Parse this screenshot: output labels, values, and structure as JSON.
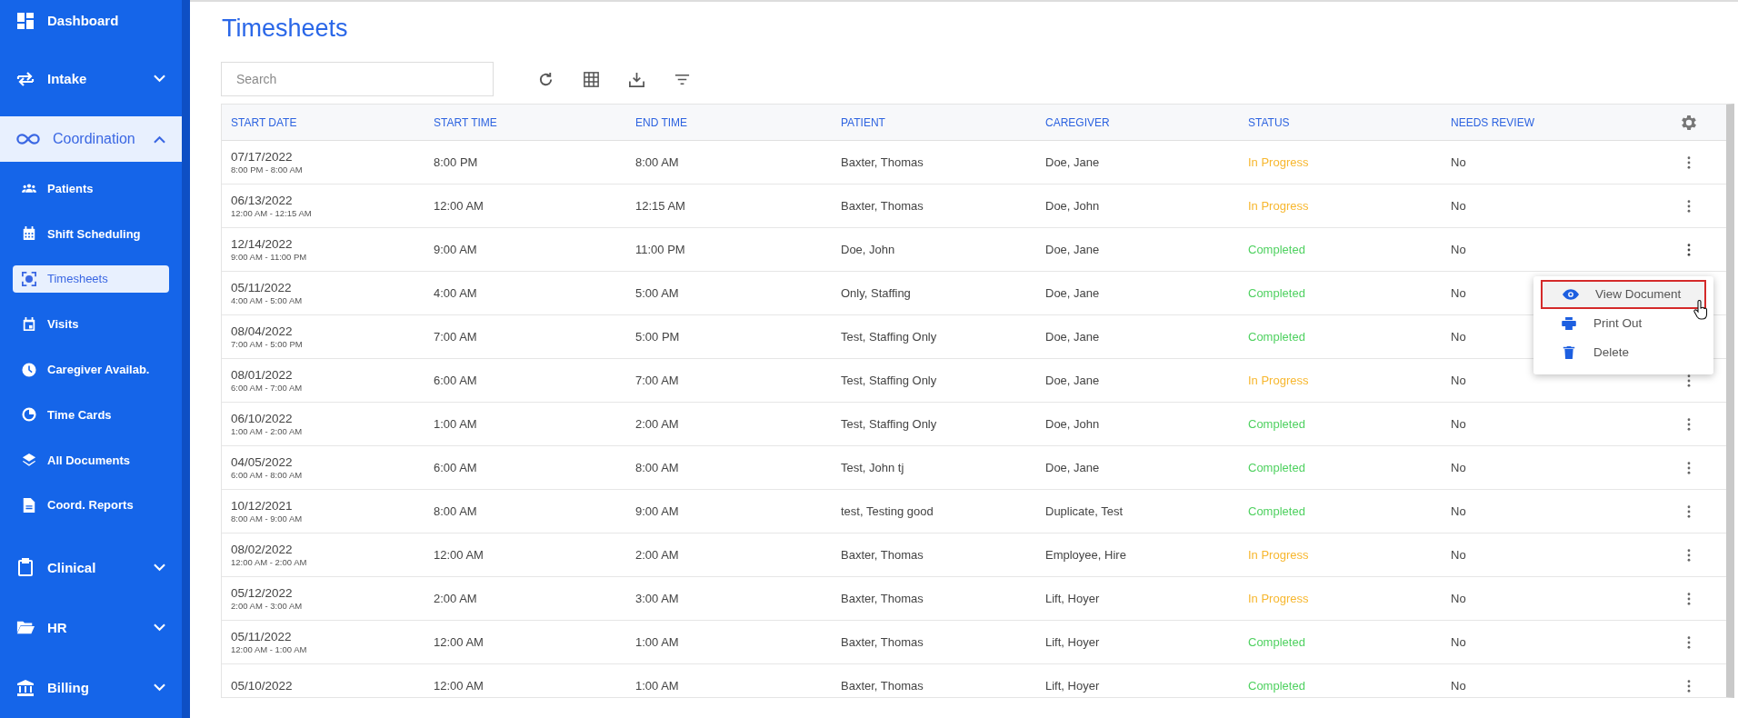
{
  "sidebar": {
    "items": [
      {
        "label": "Dashboard",
        "kind": "link",
        "selected": false
      },
      {
        "label": "Intake",
        "kind": "section",
        "selected": false,
        "expanded": false
      },
      {
        "label": "Coordination",
        "kind": "section",
        "selected": true,
        "expanded": true,
        "children": [
          {
            "label": "Patients",
            "selected": false
          },
          {
            "label": "Shift Scheduling",
            "selected": false
          },
          {
            "label": "Timesheets",
            "selected": true
          },
          {
            "label": "Visits",
            "selected": false
          },
          {
            "label": "Caregiver Availab.",
            "selected": false
          },
          {
            "label": "Time Cards",
            "selected": false
          },
          {
            "label": "All Documents",
            "selected": false
          },
          {
            "label": "Coord. Reports",
            "selected": false
          }
        ]
      },
      {
        "label": "Clinical",
        "kind": "section",
        "selected": false,
        "expanded": false
      },
      {
        "label": "HR",
        "kind": "section",
        "selected": false,
        "expanded": false
      },
      {
        "label": "Billing",
        "kind": "section",
        "selected": false,
        "expanded": false
      }
    ]
  },
  "page_title": "Timesheets",
  "search": {
    "placeholder": "Search"
  },
  "table": {
    "columns": [
      "START DATE",
      "START TIME",
      "END TIME",
      "PATIENT",
      "CAREGIVER",
      "STATUS",
      "NEEDS REVIEW"
    ],
    "rows": [
      {
        "start_date": "07/17/2022",
        "range": "8:00 PM - 8:00 AM",
        "start_time": "8:00 PM",
        "end_time": "8:00 AM",
        "patient": "Baxter, Thomas",
        "caregiver": "Doe, Jane",
        "status": {
          "text": "In Progress",
          "color": "#f7b72f"
        },
        "needs_review": "No",
        "menu_open": false
      },
      {
        "start_date": "06/13/2022",
        "range": "12:00 AM - 12:15 AM",
        "start_time": "12:00 AM",
        "end_time": "12:15 AM",
        "patient": "Baxter, Thomas",
        "caregiver": "Doe, John",
        "status": {
          "text": "In Progress",
          "color": "#f7b72f"
        },
        "needs_review": "No",
        "menu_open": false
      },
      {
        "start_date": "12/14/2022",
        "range": "9:00 AM - 11:00 PM",
        "start_time": "9:00 AM",
        "end_time": "11:00 PM",
        "patient": "Doe, John",
        "caregiver": "Doe, Jane",
        "status": {
          "text": "Completed",
          "color": "#4fd160"
        },
        "needs_review": "No",
        "menu_open": true
      },
      {
        "start_date": "05/11/2022",
        "range": "4:00 AM - 5:00 AM",
        "start_time": "4:00 AM",
        "end_time": "5:00 AM",
        "patient": "Only, Staffing",
        "caregiver": "Doe, Jane",
        "status": {
          "text": "Completed",
          "color": "#4fd160"
        },
        "needs_review": "No",
        "menu_open": false
      },
      {
        "start_date": "08/04/2022",
        "range": "7:00 AM - 5:00 PM",
        "start_time": "7:00 AM",
        "end_time": "5:00 PM",
        "patient": "Test, Staffing Only",
        "caregiver": "Doe, Jane",
        "status": {
          "text": "Completed",
          "color": "#4fd160"
        },
        "needs_review": "No",
        "menu_open": false
      },
      {
        "start_date": "08/01/2022",
        "range": "6:00 AM - 7:00 AM",
        "start_time": "6:00 AM",
        "end_time": "7:00 AM",
        "patient": "Test, Staffing Only",
        "caregiver": "Doe, Jane",
        "status": {
          "text": "In Progress",
          "color": "#f7b72f"
        },
        "needs_review": "No",
        "menu_open": false
      },
      {
        "start_date": "06/10/2022",
        "range": "1:00 AM - 2:00 AM",
        "start_time": "1:00 AM",
        "end_time": "2:00 AM",
        "patient": "Test, Staffing Only",
        "caregiver": "Doe, John",
        "status": {
          "text": "Completed",
          "color": "#4fd160"
        },
        "needs_review": "No",
        "menu_open": false
      },
      {
        "start_date": "04/05/2022",
        "range": "6:00 AM - 8:00 AM",
        "start_time": "6:00 AM",
        "end_time": "8:00 AM",
        "patient": "Test, John tj",
        "caregiver": "Doe, Jane",
        "status": {
          "text": "Completed",
          "color": "#4fd160"
        },
        "needs_review": "No",
        "menu_open": false
      },
      {
        "start_date": "10/12/2021",
        "range": "8:00 AM - 9:00 AM",
        "start_time": "8:00 AM",
        "end_time": "9:00 AM",
        "patient": "test, Testing good",
        "caregiver": "Duplicate, Test",
        "status": {
          "text": "Completed",
          "color": "#4fd160"
        },
        "needs_review": "No",
        "menu_open": false
      },
      {
        "start_date": "08/02/2022",
        "range": "12:00 AM - 2:00 AM",
        "start_time": "12:00 AM",
        "end_time": "2:00 AM",
        "patient": "Baxter, Thomas",
        "caregiver": "Employee, Hire",
        "status": {
          "text": "In Progress",
          "color": "#f7b72f"
        },
        "needs_review": "No",
        "menu_open": false
      },
      {
        "start_date": "05/12/2022",
        "range": "2:00 AM - 3:00 AM",
        "start_time": "2:00 AM",
        "end_time": "3:00 AM",
        "patient": "Baxter, Thomas",
        "caregiver": "Lift, Hoyer",
        "status": {
          "text": "In Progress",
          "color": "#f7b72f"
        },
        "needs_review": "No",
        "menu_open": false
      },
      {
        "start_date": "05/11/2022",
        "range": "12:00 AM - 1:00 AM",
        "start_time": "12:00 AM",
        "end_time": "1:00 AM",
        "patient": "Baxter, Thomas",
        "caregiver": "Lift, Hoyer",
        "status": {
          "text": "Completed",
          "color": "#4fd160"
        },
        "needs_review": "No",
        "menu_open": false
      },
      {
        "start_date": "05/10/2022",
        "start_time": "12:00 AM",
        "end_time": "1:00 AM",
        "patient": "Baxter, Thomas",
        "caregiver": "Lift, Hoyer",
        "status": {
          "text": "Completed",
          "color": "#4fd160"
        },
        "needs_review": "No",
        "menu_open": false
      }
    ]
  },
  "context_menu": {
    "items": [
      {
        "label": "View Document",
        "selected": true
      },
      {
        "label": "Print Out",
        "selected": false
      },
      {
        "label": "Delete",
        "selected": false
      }
    ]
  }
}
